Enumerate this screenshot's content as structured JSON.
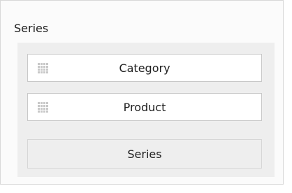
{
  "section": {
    "title": "Series"
  },
  "items": [
    {
      "label": "Category",
      "icon": "drag-handle-icon"
    },
    {
      "label": "Product",
      "icon": "drag-handle-icon"
    }
  ],
  "placeholder": {
    "label": "Series"
  }
}
